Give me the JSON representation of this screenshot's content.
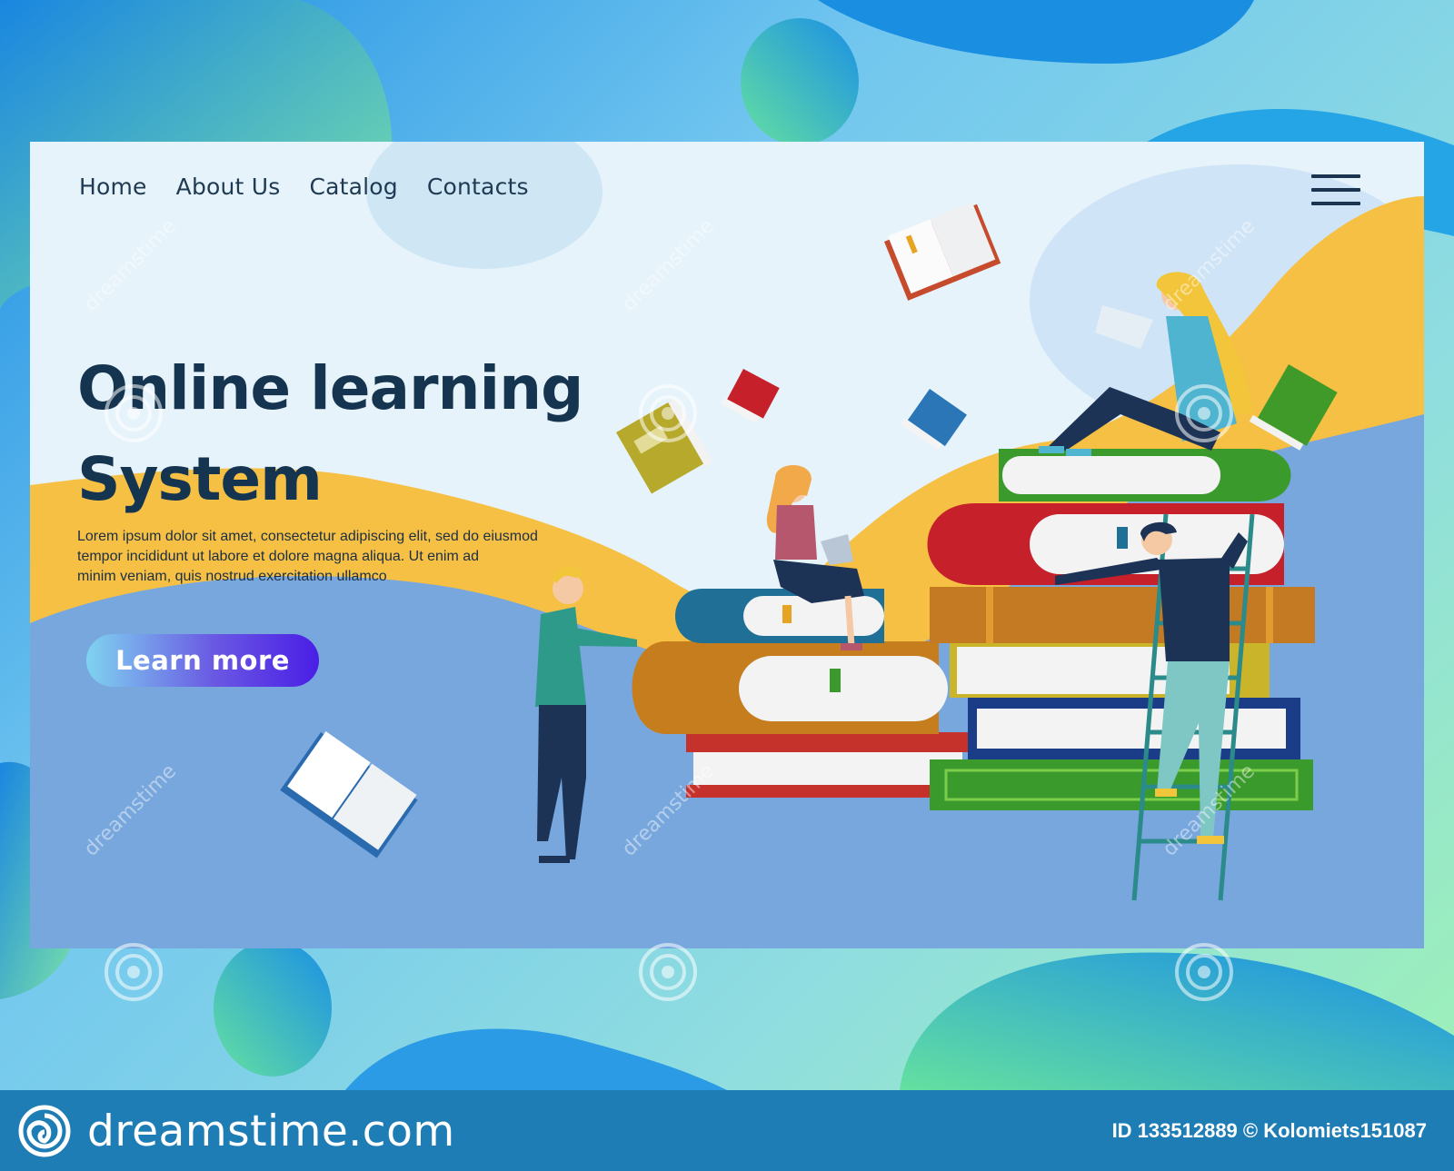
{
  "nav": {
    "items": [
      "Home",
      "About Us",
      "Catalog",
      "Contacts"
    ]
  },
  "hero": {
    "title_line1": "Online learning",
    "title_line2": "System",
    "description_line1": "Lorem ipsum dolor sit amet, consectetur adipiscing elit, sed do eiusmod",
    "description_line2": "tempor incididunt ut labore et dolore magna aliqua. Ut enim ad",
    "description_line3": "minim veniam, quis nostrud exercitation ullamco",
    "cta_label": "Learn more"
  },
  "footer": {
    "logo_text": "dreamstime.com",
    "credit": "ID 133512889 © Kolomiets151087"
  },
  "watermark": "dreamstime",
  "colors": {
    "heading": "#15344f",
    "yellow_wave": "#f6c044",
    "blue_ground": "#77a7dd",
    "footer": "#1f7db5",
    "button_start": "#7fd3f0",
    "button_end": "#4a1ee6"
  },
  "icons": {
    "menu": "hamburger-icon",
    "logo": "dreamstime-spiral-logo"
  }
}
